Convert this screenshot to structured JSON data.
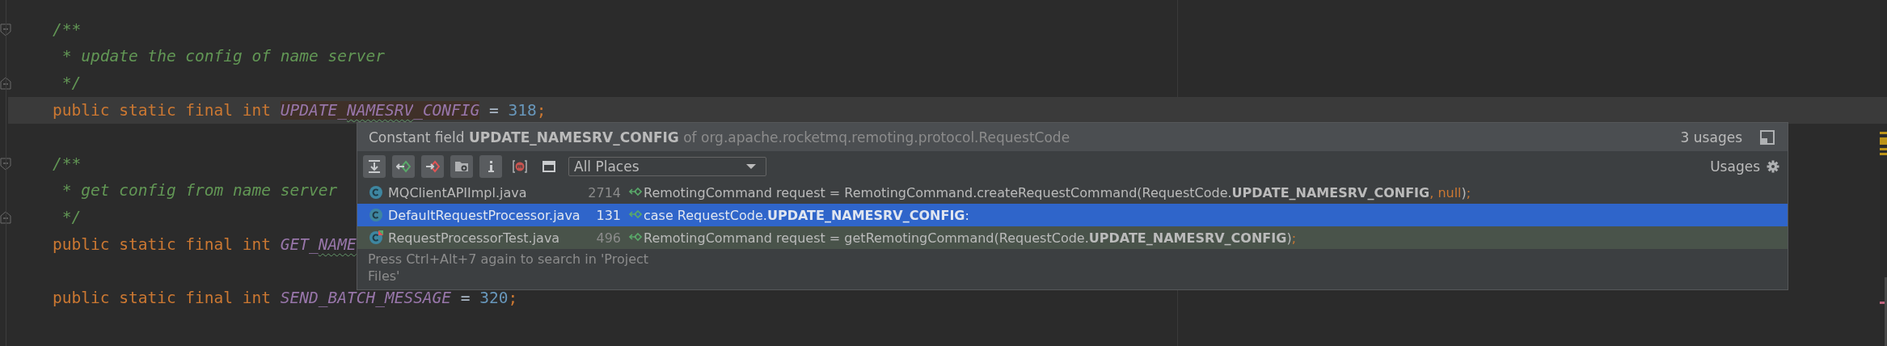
{
  "editor": {
    "lines": [
      {
        "kind": "code",
        "fold_open": true,
        "tokens": [
          {
            "kind": "comment",
            "text": "/**"
          }
        ]
      },
      {
        "kind": "code",
        "tokens": [
          {
            "kind": "comment",
            "text": " * update the config of name server"
          }
        ]
      },
      {
        "kind": "code",
        "fold_close": true,
        "tokens": [
          {
            "kind": "comment",
            "text": " */"
          }
        ]
      },
      {
        "kind": "code",
        "current": true,
        "tokens": [
          {
            "kind": "kw",
            "text": "public static final int "
          },
          {
            "kind": "field",
            "text": "UPDATE_",
            "highlighted": true
          },
          {
            "kind": "field",
            "text": "NAMESRV",
            "highlighted": true,
            "typo": true
          },
          {
            "kind": "field",
            "text": "_CONFIG",
            "highlighted": true
          },
          {
            "kind": "plain",
            "text": " = "
          },
          {
            "kind": "num",
            "text": "318"
          },
          {
            "kind": "kw",
            "text": ";"
          }
        ]
      },
      {
        "kind": "blank"
      },
      {
        "kind": "code",
        "fold_open": true,
        "tokens": [
          {
            "kind": "comment",
            "text": "/**"
          }
        ]
      },
      {
        "kind": "code",
        "tokens": [
          {
            "kind": "comment",
            "text": " * get config from name server"
          }
        ]
      },
      {
        "kind": "code",
        "fold_close": true,
        "tokens": [
          {
            "kind": "comment",
            "text": " */"
          }
        ]
      },
      {
        "kind": "code",
        "tokens": [
          {
            "kind": "kw",
            "text": "public static final int "
          },
          {
            "kind": "field",
            "text": "GET_"
          },
          {
            "kind": "field",
            "text": "NAME",
            "typo": true
          }
        ]
      },
      {
        "kind": "blank"
      },
      {
        "kind": "code",
        "tokens": [
          {
            "kind": "kw",
            "text": "public static final int "
          },
          {
            "kind": "field",
            "text": "SEND_BATCH_MESSAGE"
          },
          {
            "kind": "plain",
            "text": " = "
          },
          {
            "kind": "num",
            "text": "320"
          },
          {
            "kind": "kw",
            "text": ";"
          }
        ]
      }
    ]
  },
  "popup": {
    "title": "Constant field",
    "symbol": "UPDATE_NAMESRV_CONFIG",
    "qualifier": "of org.apache.rocketmq.remoting.protocol.RequestCode",
    "count": "3 usages",
    "scope": "All Places",
    "group_label": "Usages",
    "toolbar": [
      {
        "kind": "expand",
        "on": true
      },
      {
        "kind": "prev",
        "on": true
      },
      {
        "kind": "next",
        "on": true
      },
      {
        "kind": "folder",
        "on": true
      },
      {
        "kind": "info",
        "on": true
      },
      {
        "kind": "module",
        "on": false
      },
      {
        "kind": "window",
        "on": false
      }
    ],
    "results": [
      {
        "kind": "main",
        "selected": false,
        "file": "MQClientAPIImpl.java",
        "line": "2714",
        "code": [
          {
            "kind": "plain",
            "text": "RemotingCommand request = RemotingCommand.createRequestCommand(RequestCode."
          },
          {
            "kind": "bold",
            "text": "UPDATE_NAMESRV_CONFIG"
          },
          {
            "kind": "kw",
            "text": ", null"
          },
          {
            "kind": "plain",
            "text": ")"
          },
          {
            "kind": "kw",
            "text": ";"
          }
        ]
      },
      {
        "kind": "main",
        "selected": true,
        "file": "DefaultRequestProcessor.java",
        "line": "131",
        "code": [
          {
            "kind": "plain",
            "text": "case RequestCode."
          },
          {
            "kind": "bold",
            "text": "UPDATE_NAMESRV_CONFIG"
          },
          {
            "kind": "plain",
            "text": ":"
          }
        ]
      },
      {
        "kind": "test",
        "selected": false,
        "file": "RequestProcessorTest.java",
        "line": "496",
        "code": [
          {
            "kind": "plain",
            "text": "RemotingCommand request = getRemotingCommand(RequestCode."
          },
          {
            "kind": "bold",
            "text": "UPDATE_NAMESRV_CONFIG"
          },
          {
            "kind": "plain",
            "text": ")"
          },
          {
            "kind": "kw",
            "text": ";"
          }
        ]
      }
    ],
    "hint": "Press Ctrl+Alt+7 again to search in 'Project Files'"
  }
}
